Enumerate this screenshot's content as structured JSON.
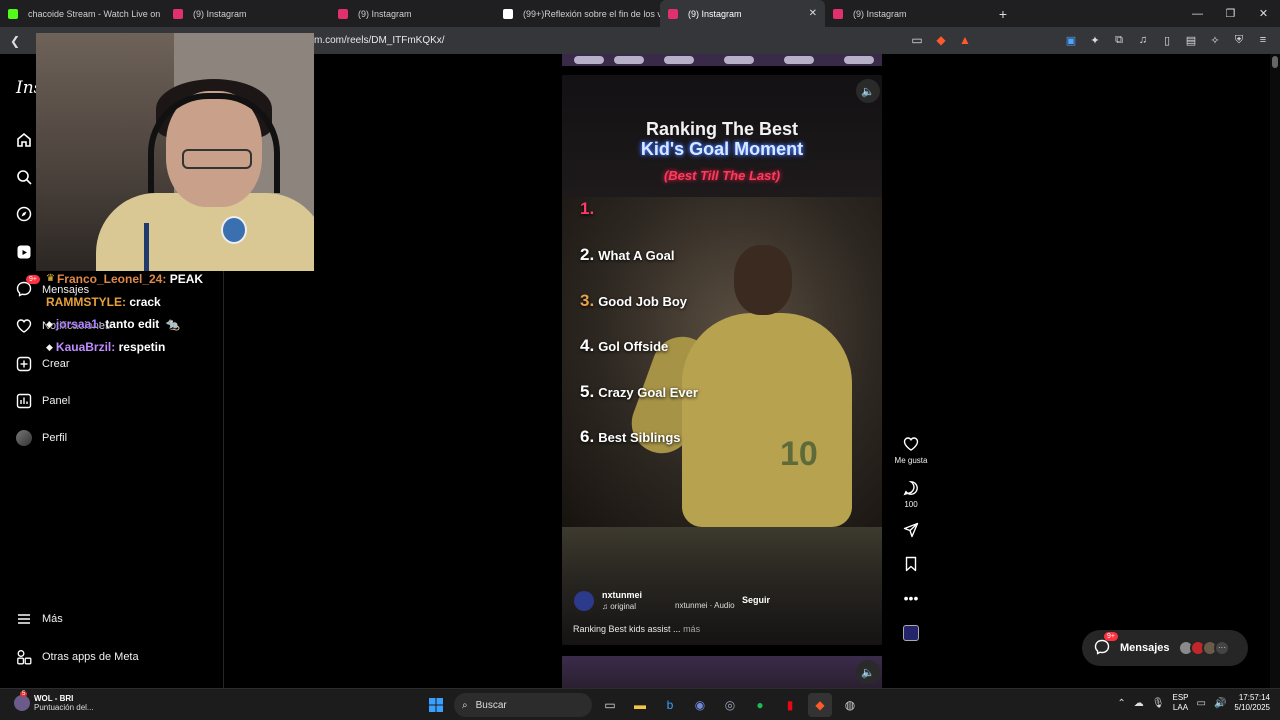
{
  "browser": {
    "tabs": [
      {
        "label": "chacoide Stream - Watch Live on",
        "favicon_color": "#53fc18",
        "active": false
      },
      {
        "label": "(9) Instagram",
        "favicon_color": "#e1306c",
        "active": false
      },
      {
        "label": "(9) Instagram",
        "favicon_color": "#e1306c",
        "active": false
      },
      {
        "label": "(99+)Reflexión sobre el fin de los vid",
        "favicon_color": "#ffffff",
        "active": false
      },
      {
        "label": "(9) Instagram",
        "favicon_color": "#e1306c",
        "active": true
      },
      {
        "label": "(9) Instagram",
        "favicon_color": "#e1306c",
        "active": false
      }
    ],
    "url": "m.com/reels/DM_ITFmKQKx/",
    "extension_badge": "5"
  },
  "sidebar": {
    "logo": "Ins",
    "items": [
      {
        "label": "",
        "icon": "home-icon"
      },
      {
        "label": "",
        "icon": "search-icon"
      },
      {
        "label": "",
        "icon": "explore-icon"
      },
      {
        "label": "",
        "icon": "reels-icon"
      },
      {
        "label": "Mensajes",
        "icon": "messenger-icon",
        "badge": "9+"
      },
      {
        "label": "Notificaciones",
        "icon": "heart-icon"
      },
      {
        "label": "Crear",
        "icon": "plus-icon"
      },
      {
        "label": "Panel",
        "icon": "chart-icon"
      },
      {
        "label": "Perfil",
        "icon": "avatar"
      }
    ],
    "more": "Más",
    "meta_apps": "Otras apps de Meta"
  },
  "chat": [
    {
      "user": "Franco_Leonel_24:",
      "msg": "PEAK"
    },
    {
      "user": "RAMMSTYLE:",
      "msg": "crack"
    },
    {
      "user": "jorsaa1:",
      "msg": "tanto edit"
    },
    {
      "user": "KauaBrzil:",
      "msg": "respetin"
    }
  ],
  "reel": {
    "title1": "Ranking The Best",
    "title2": "Kid's Goal Moment",
    "title3": "(Best Till The Last)",
    "ranks": [
      {
        "num": "1.",
        "text": ""
      },
      {
        "num": "2.",
        "text": "What A Goal"
      },
      {
        "num": "3.",
        "text": "Good Job Boy"
      },
      {
        "num": "4.",
        "text": "Gol Offside"
      },
      {
        "num": "5.",
        "text": "Crazy Goal Ever"
      },
      {
        "num": "6.",
        "text": "Best Siblings"
      }
    ],
    "jersey_number": "10",
    "author": "nxtunmei",
    "audio": "original",
    "audio_credit": "nxtunmei · Audio",
    "follow": "Seguir",
    "caption": "Ranking Best kids assist ...",
    "caption_more": "más"
  },
  "actions": {
    "like_label": "Me gusta",
    "comments_count": "100"
  },
  "messages_pill": {
    "label": "Mensajes",
    "badge": "9+"
  },
  "taskbar": {
    "weather_title": "WOL - BRI",
    "weather_sub": "Puntuación del...",
    "weather_badge": "5",
    "search_placeholder": "Buscar",
    "lang1": "ESP",
    "lang2": "LAA",
    "time": "17:57:14",
    "date": "5/10/2025"
  }
}
